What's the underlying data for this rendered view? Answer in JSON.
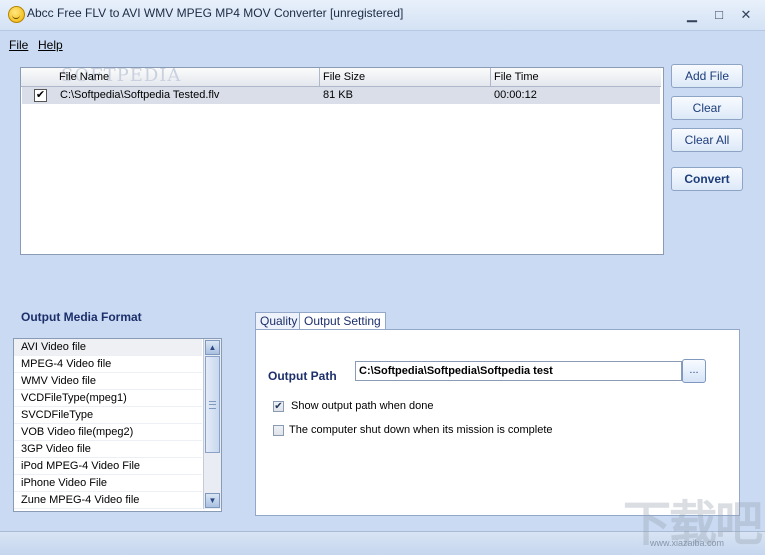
{
  "window": {
    "title": "Abcc Free FLV to AVI WMV MPEG MP4 MOV Converter  [unregistered]",
    "minimize": "▁",
    "maximize": "□",
    "close": "✕"
  },
  "menu": {
    "file": "File",
    "help": "Help"
  },
  "file_list": {
    "watermark": "SOFTPEDIA",
    "columns": [
      "File Name",
      "File Size",
      "File Time"
    ],
    "rows": [
      {
        "checked": "✔",
        "name": "C:\\Softpedia\\Softpedia Tested.flv",
        "size": "81 KB",
        "time": "00:00:12"
      }
    ]
  },
  "buttons": {
    "add_file": "Add File",
    "clear": "Clear",
    "clear_all": "Clear All",
    "convert": "Convert"
  },
  "format": {
    "title": "Output Media Format",
    "items": [
      "AVI Video file",
      "MPEG-4 Video file",
      "WMV Video file",
      "VCDFileType(mpeg1)",
      "SVCDFileType",
      "VOB Video file(mpeg2)",
      "3GP Video file",
      "iPod MPEG-4 Video File",
      "iPhone Video File",
      "Zune MPEG-4 Video file"
    ],
    "selected": "AVI Video file"
  },
  "tabs": {
    "quality": "Quality",
    "output_setting": "Output Setting"
  },
  "output": {
    "label": "Output Path",
    "path": "C:\\Softpedia\\Softpedia\\Softpedia test",
    "browse": "...",
    "show_path_label": "Show output path when done",
    "show_path_checked": "✔",
    "shutdown_label": "The computer shut down when its mission is complete"
  },
  "watermark_site": {
    "logo": "下载吧",
    "url": "www.xiazaiba.com"
  }
}
